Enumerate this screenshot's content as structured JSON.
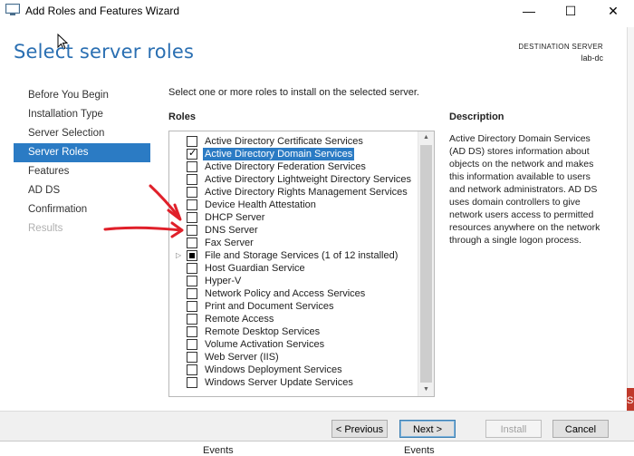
{
  "window": {
    "title": "Add Roles and Features Wizard",
    "minimize_glyph": "—",
    "maximize_glyph": "☐",
    "close_glyph": "✕"
  },
  "header": {
    "title": "Select server roles",
    "dest_label": "DESTINATION SERVER",
    "dest_name": "lab-dc"
  },
  "nav": {
    "items": [
      {
        "label": "Before You Begin",
        "state": "normal"
      },
      {
        "label": "Installation Type",
        "state": "normal"
      },
      {
        "label": "Server Selection",
        "state": "normal"
      },
      {
        "label": "Server Roles",
        "state": "active"
      },
      {
        "label": "Features",
        "state": "normal"
      },
      {
        "label": "AD DS",
        "state": "normal"
      },
      {
        "label": "Confirmation",
        "state": "normal"
      },
      {
        "label": "Results",
        "state": "disabled"
      }
    ]
  },
  "main": {
    "intro": "Select one or more roles to install on the selected server.",
    "roles_heading": "Roles",
    "description_heading": "Description",
    "description": "Active Directory Domain Services (AD DS) stores information about objects on the network and makes this information available to users and network administrators. AD DS uses domain controllers to give network users access to permitted resources anywhere on the network through a single logon process."
  },
  "roles": [
    {
      "label": "Active Directory Certificate Services",
      "state": "unchecked"
    },
    {
      "label": "Active Directory Domain Services",
      "state": "checked",
      "selected": true
    },
    {
      "label": "Active Directory Federation Services",
      "state": "unchecked"
    },
    {
      "label": "Active Directory Lightweight Directory Services",
      "state": "unchecked"
    },
    {
      "label": "Active Directory Rights Management Services",
      "state": "unchecked"
    },
    {
      "label": "Device Health Attestation",
      "state": "unchecked"
    },
    {
      "label": "DHCP Server",
      "state": "unchecked"
    },
    {
      "label": "DNS Server",
      "state": "unchecked"
    },
    {
      "label": "Fax Server",
      "state": "unchecked"
    },
    {
      "label": "File and Storage Services (1 of 12 installed)",
      "state": "partial",
      "expandable": true
    },
    {
      "label": "Host Guardian Service",
      "state": "unchecked"
    },
    {
      "label": "Hyper-V",
      "state": "unchecked"
    },
    {
      "label": "Network Policy and Access Services",
      "state": "unchecked"
    },
    {
      "label": "Print and Document Services",
      "state": "unchecked"
    },
    {
      "label": "Remote Access",
      "state": "unchecked"
    },
    {
      "label": "Remote Desktop Services",
      "state": "unchecked"
    },
    {
      "label": "Volume Activation Services",
      "state": "unchecked"
    },
    {
      "label": "Web Server (IIS)",
      "state": "unchecked"
    },
    {
      "label": "Windows Deployment Services",
      "state": "unchecked"
    },
    {
      "label": "Windows Server Update Services",
      "state": "unchecked"
    }
  ],
  "buttons": {
    "previous": "< Previous",
    "next": "Next >",
    "install": "Install",
    "cancel": "Cancel"
  },
  "background": {
    "events_1": "Events",
    "events_2": "Events",
    "red_tab_text": "Se"
  },
  "colors": {
    "accent": "#2b7bc4",
    "header_title": "#2a6fb2",
    "annotation_arrows": "#e0202a"
  },
  "icons": {
    "checked": "✓",
    "expander": "▷",
    "scroll_up": "▲",
    "scroll_down": "▼"
  }
}
